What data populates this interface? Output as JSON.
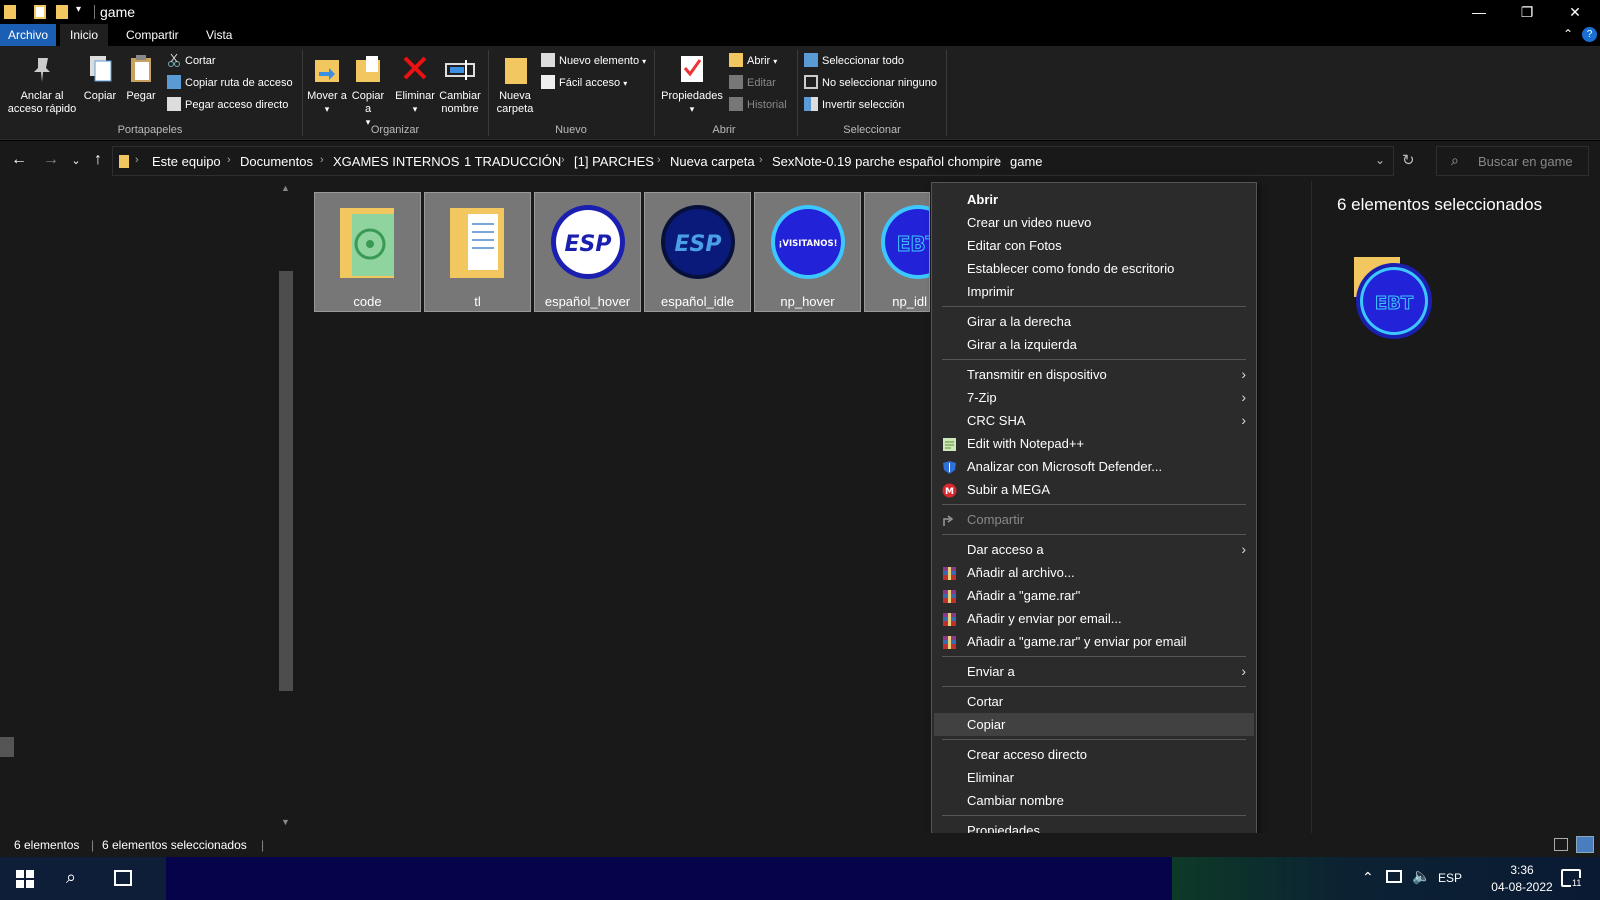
{
  "window": {
    "title": "game",
    "minimize": "—",
    "restore": "❐",
    "close": "✕"
  },
  "tabs": [
    "Archivo",
    "Inicio",
    "Compartir",
    "Vista"
  ],
  "ribbon": {
    "portapapeles": {
      "label": "Portapapeles",
      "anclar": "Anclar al acceso rápido",
      "copiar": "Copiar",
      "pegar": "Pegar",
      "cortar": "Cortar",
      "copiar_ruta": "Copiar ruta de acceso",
      "pegar_acceso": "Pegar acceso directo"
    },
    "organizar": {
      "label": "Organizar",
      "mover": "Mover a",
      "copiar_a": "Copiar a",
      "eliminar": "Eliminar",
      "cambiar_nombre": "Cambiar nombre"
    },
    "nuevo": {
      "label": "Nuevo",
      "nueva_carpeta": "Nueva carpeta",
      "nuevo_elemento": "Nuevo elemento",
      "facil_acceso": "Fácil acceso"
    },
    "abrir": {
      "label": "Abrir",
      "propiedades": "Propiedades",
      "abrir": "Abrir",
      "editar": "Editar",
      "historial": "Historial"
    },
    "seleccionar": {
      "label": "Seleccionar",
      "todo": "Seleccionar todo",
      "ninguno": "No seleccionar ninguno",
      "invertir": "Invertir selección"
    }
  },
  "breadcrumb": [
    "Este equipo",
    "Documentos",
    "XGAMES INTERNOS",
    "1 TRADUCCIÓN",
    "[1] PARCHES",
    "Nueva carpeta",
    "SexNote-0.19 parche español chompire",
    "game"
  ],
  "search": {
    "placeholder": "Buscar en game"
  },
  "files": [
    {
      "name": "code",
      "kind": "folder"
    },
    {
      "name": "tl",
      "kind": "folder"
    },
    {
      "name": "español_hover",
      "kind": "image",
      "text": "ESP"
    },
    {
      "name": "español_idle",
      "kind": "image",
      "text": "ESP"
    },
    {
      "name": "np_hover",
      "kind": "image",
      "text": "¡VISITANOS!"
    },
    {
      "name": "np_idl",
      "kind": "image",
      "text": "EBT"
    }
  ],
  "preview": {
    "title": "6 elementos seleccionados",
    "thumb_text": "EBT"
  },
  "status": {
    "count": "6 elementos",
    "selected": "6 elementos seleccionados"
  },
  "taskbar": {
    "lang": "ESP",
    "time": "3:36",
    "date": "04-08-2022",
    "notif_count": "11"
  },
  "context_menu": {
    "groups": [
      [
        {
          "label": "Abrir",
          "bold": true
        },
        {
          "label": "Crear un video nuevo"
        },
        {
          "label": "Editar con Fotos"
        },
        {
          "label": "Establecer como fondo de escritorio"
        },
        {
          "label": "Imprimir"
        }
      ],
      [
        {
          "label": "Girar a la derecha"
        },
        {
          "label": "Girar a la izquierda"
        }
      ],
      [
        {
          "label": "Transmitir en dispositivo",
          "submenu": true
        },
        {
          "label": "7-Zip",
          "submenu": true
        },
        {
          "label": "CRC SHA",
          "submenu": true
        },
        {
          "label": "Edit with Notepad++",
          "icon": "notepad-icon"
        },
        {
          "label": "Analizar con Microsoft Defender...",
          "icon": "defender-icon"
        },
        {
          "label": "Subir a MEGA",
          "icon": "mega-icon"
        }
      ],
      [
        {
          "label": "Compartir",
          "icon": "share-icon",
          "disabled": true
        }
      ],
      [
        {
          "label": "Dar acceso a",
          "submenu": true
        },
        {
          "label": "Añadir al archivo...",
          "icon": "winrar-icon"
        },
        {
          "label": "Añadir a \"game.rar\"",
          "icon": "winrar-icon"
        },
        {
          "label": "Añadir y enviar por email...",
          "icon": "winrar-icon"
        },
        {
          "label": "Añadir a \"game.rar\" y enviar por email",
          "icon": "winrar-icon"
        }
      ],
      [
        {
          "label": "Enviar a",
          "submenu": true
        }
      ],
      [
        {
          "label": "Cortar"
        },
        {
          "label": "Copiar",
          "highlighted": true
        }
      ],
      [
        {
          "label": "Crear acceso directo"
        },
        {
          "label": "Eliminar"
        },
        {
          "label": "Cambiar nombre"
        }
      ],
      [
        {
          "label": "Propiedades"
        }
      ]
    ]
  },
  "colors": {
    "accent": "#1a5fb4",
    "folder": "#f3c75f",
    "esp_blue": "#1f2fd0"
  }
}
